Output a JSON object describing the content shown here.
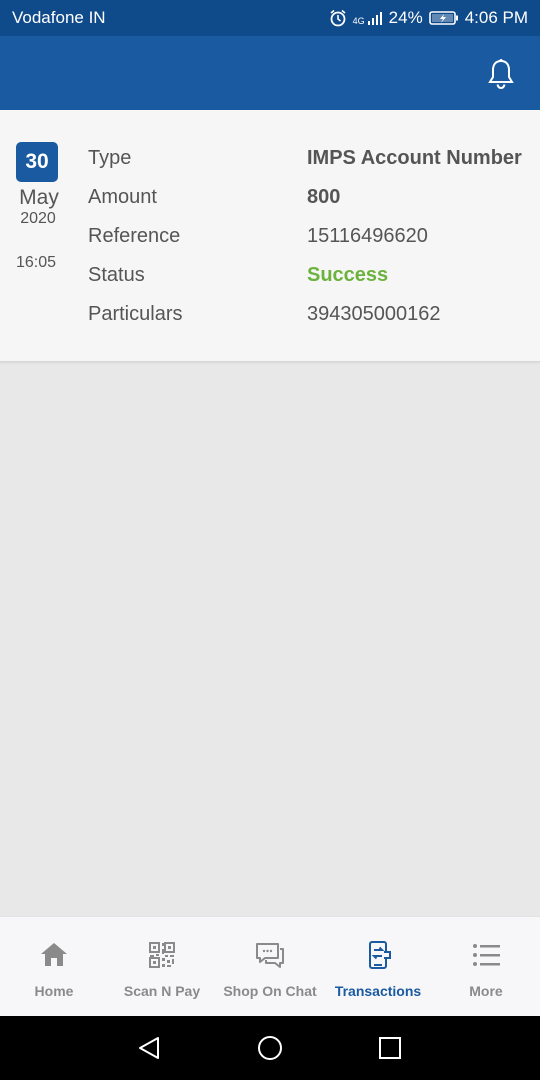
{
  "status_bar": {
    "carrier": "Vodafone IN",
    "network": "4G",
    "battery": "24%",
    "time": "4:06 PM"
  },
  "transaction": {
    "day": "30",
    "month": "May",
    "year": "2020",
    "time": "16:05",
    "rows": [
      {
        "label": "Type",
        "value": "IMPS Account Number"
      },
      {
        "label": "Amount",
        "value": "800"
      },
      {
        "label": "Reference",
        "value": "15116496620"
      },
      {
        "label": "Status",
        "value": "Success"
      },
      {
        "label": "Particulars",
        "value": "394305000162"
      }
    ]
  },
  "bottom_nav": {
    "items": [
      {
        "label": "Home",
        "icon": "home-icon"
      },
      {
        "label": "Scan N Pay",
        "icon": "qr-code-icon"
      },
      {
        "label": "Shop On Chat",
        "icon": "chat-icon"
      },
      {
        "label": "Transactions",
        "icon": "transactions-icon",
        "active": true
      },
      {
        "label": "More",
        "icon": "list-icon"
      }
    ]
  },
  "colors": {
    "primary": "#1a5aa0",
    "status_bar": "#0f4a8a",
    "success": "#6cb33e",
    "inactive": "#8a8a8a"
  }
}
